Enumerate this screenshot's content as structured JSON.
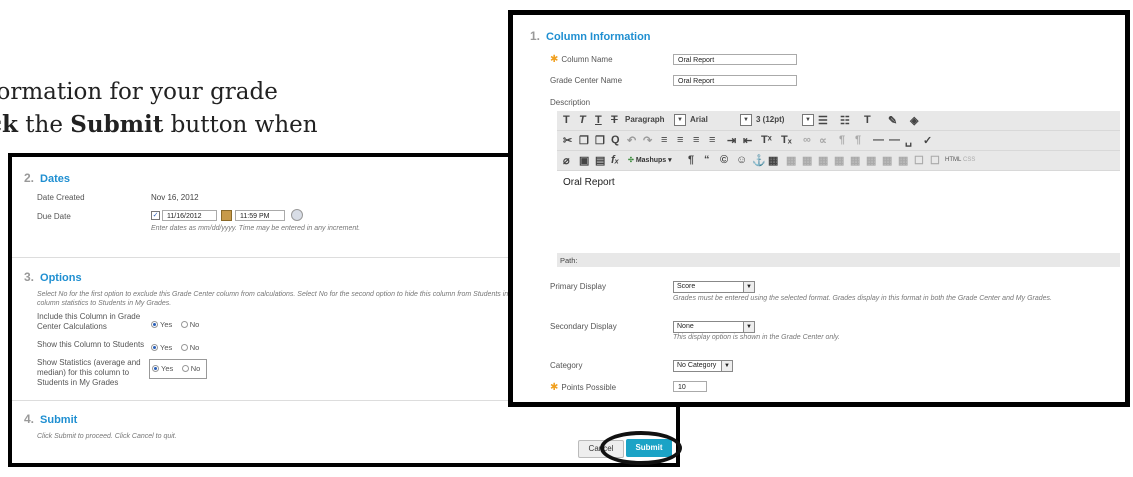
{
  "intro": {
    "line1": "formation for your grade",
    "line2_a": "ck",
    "line2_b": " the ",
    "line2_c": "Submit",
    "line2_d": " button when"
  },
  "dates": {
    "num": "2.",
    "title": "Dates",
    "created_label": "Date Created",
    "created_value": "Nov 16, 2012",
    "due_label": "Due Date",
    "due_date": "11/16/2012",
    "due_time": "11:59 PM",
    "hint": "Enter dates as mm/dd/yyyy. Time may be entered in any increment."
  },
  "options": {
    "num": "3.",
    "title": "Options",
    "hint1": "Select No for the first option to exclude this Grade Center column from calculations. Select No for the second option to hide this column from Students in",
    "hint2": "column statistics to Students in My Grades.",
    "opt1_l1": "Include this Column in Grade",
    "opt1_l2": "Center Calculations",
    "opt2": "Show this Column to Students",
    "opt3_l1": "Show Statistics (average and",
    "opt3_l2": "median) for this column to",
    "opt3_l3": "Students in My Grades",
    "yes": "Yes",
    "no": "No"
  },
  "submit": {
    "num": "4.",
    "title": "Submit",
    "hint": "Click Submit to proceed. Click Cancel to quit.",
    "cancel_label": "Cancel",
    "submit_label": "Submit"
  },
  "colinfo": {
    "num": "1.",
    "title": "Column Information",
    "name_label": "Column Name",
    "name_value": "Oral Report",
    "gc_label": "Grade Center Name",
    "gc_value": "Oral Report",
    "desc_label": "Description",
    "paragraph": "Paragraph",
    "font": "Arial",
    "size": "3 (12pt)",
    "mashups": "Mashups",
    "html": "HTML",
    "css": "CSS",
    "editor_text": "Oral Report",
    "path_label": "Path:",
    "primary_label": "Primary Display",
    "primary_value": "Score",
    "primary_hint": "Grades must be entered using the selected format. Grades display in this format in both the Grade Center and My Grades.",
    "secondary_label": "Secondary Display",
    "secondary_value": "None",
    "secondary_hint": "This display option is shown in the Grade Center only.",
    "category_label": "Category",
    "category_value": "No Category",
    "points_label": "Points Possible",
    "points_value": "10"
  },
  "colors": {
    "accent": "#1f8fd1",
    "submit_btn": "#1ba3c6",
    "required": "#f0a020"
  }
}
